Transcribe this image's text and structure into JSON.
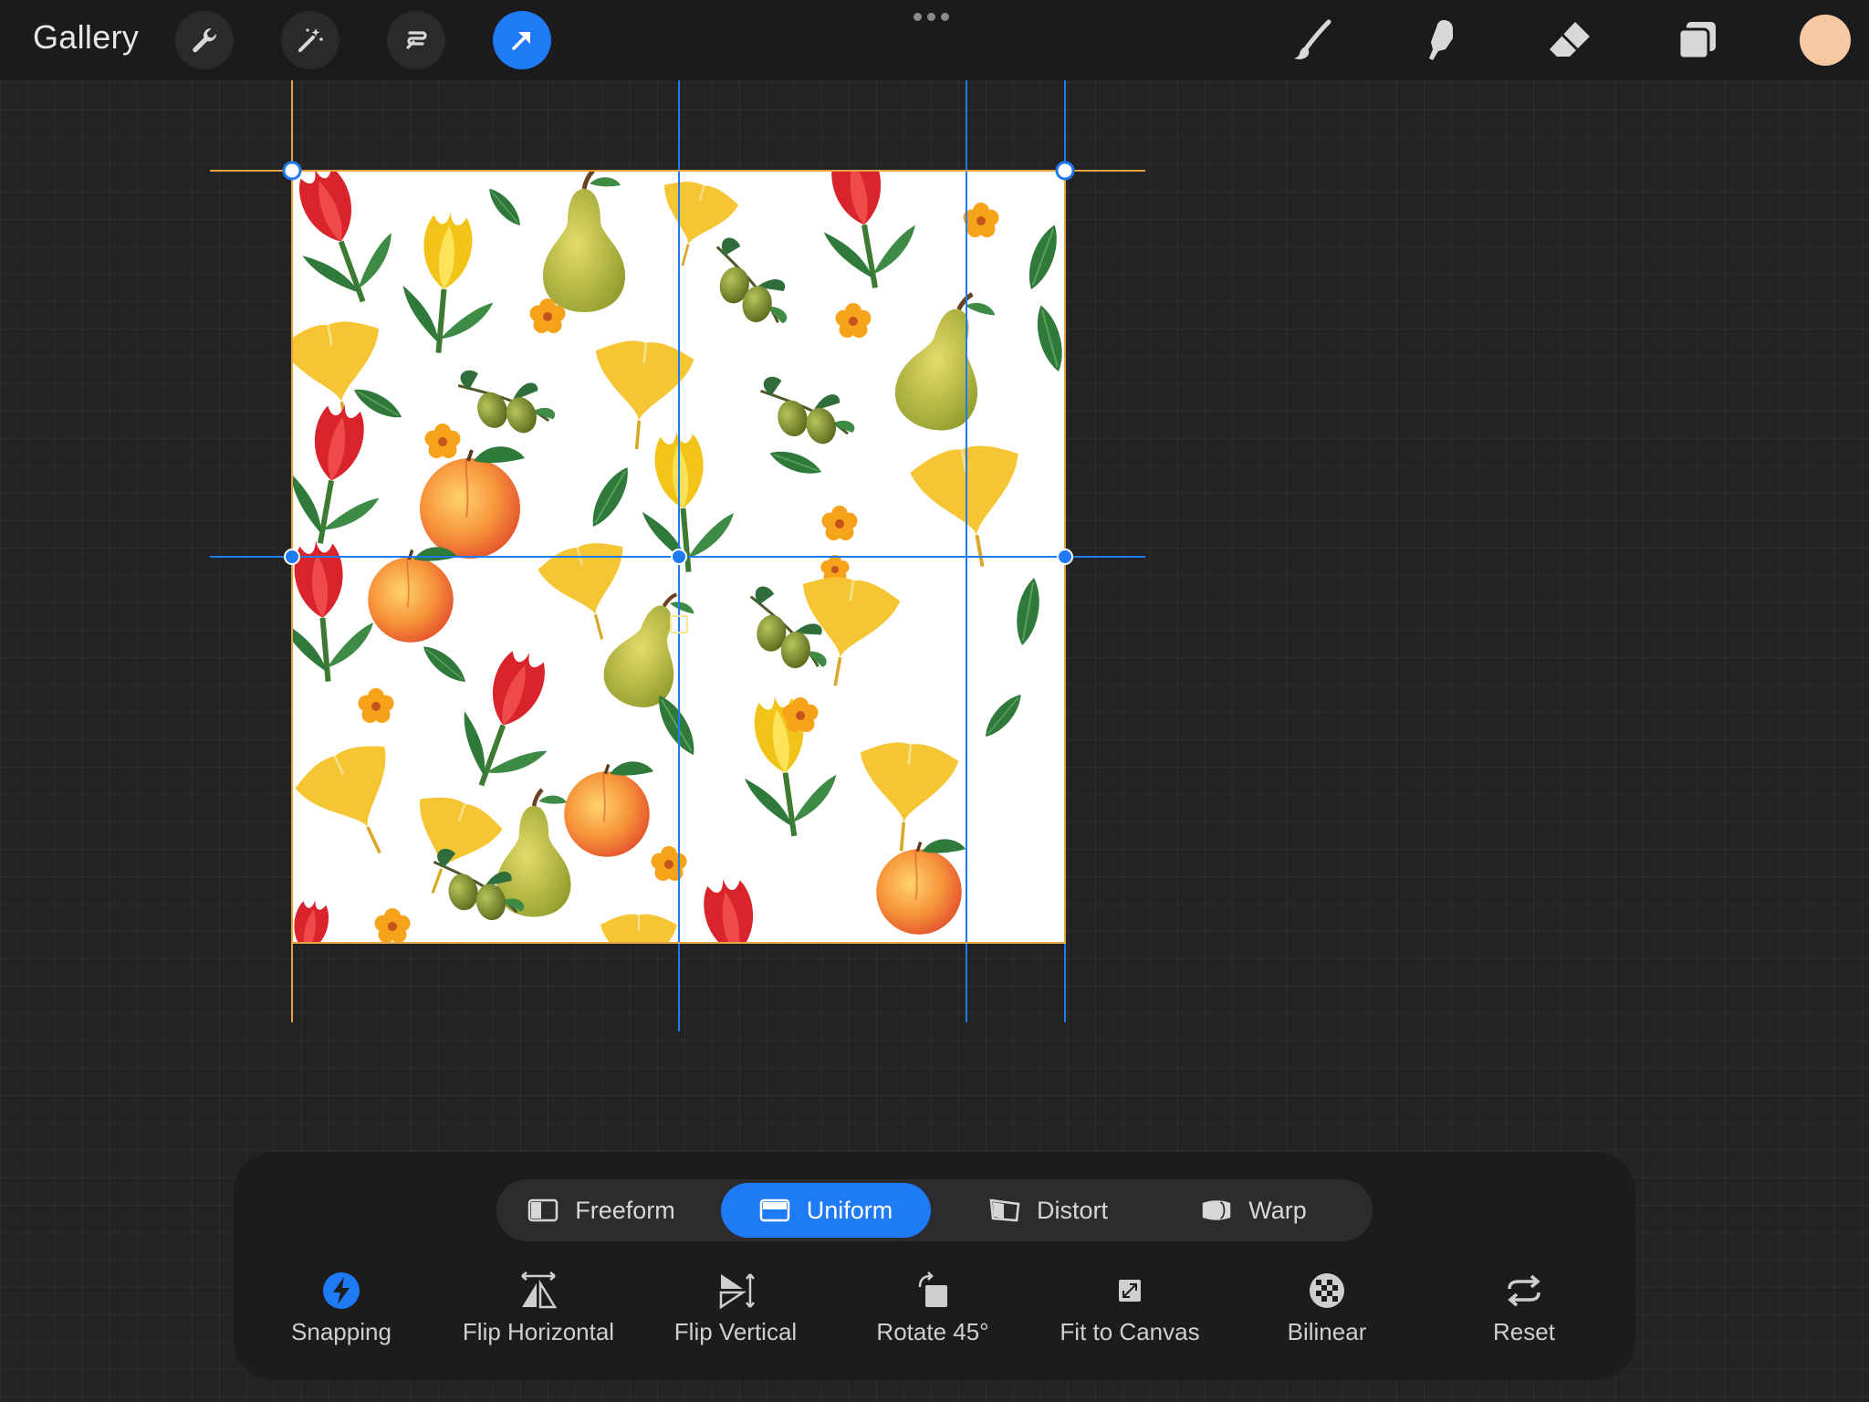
{
  "topbar": {
    "gallery_label": "Gallery",
    "left_tools": [
      {
        "name": "actions-wrench-icon",
        "active": false
      },
      {
        "name": "adjustments-magic-wand-icon",
        "active": false
      },
      {
        "name": "selection-icon",
        "active": false
      },
      {
        "name": "transform-arrow-icon",
        "active": true
      }
    ],
    "right_tools": [
      "brush-icon",
      "smudge-icon",
      "eraser-icon",
      "layers-icon"
    ],
    "current_color": "#f7c9a3",
    "accent_color": "#1f7af5"
  },
  "canvas": {
    "artwork_description_icon": "floral-fruit-pattern-image",
    "guide_color": "#1f7af5",
    "snap_guide_color": "#e6a23c"
  },
  "transform_panel": {
    "modes": [
      {
        "label": "Freeform",
        "icon": "freeform-icon",
        "active": false
      },
      {
        "label": "Uniform",
        "icon": "uniform-icon",
        "active": true
      },
      {
        "label": "Distort",
        "icon": "distort-icon",
        "active": false
      },
      {
        "label": "Warp",
        "icon": "warp-icon",
        "active": false
      }
    ],
    "actions": [
      {
        "label": "Snapping",
        "icon": "snapping-lightning-icon"
      },
      {
        "label": "Flip Horizontal",
        "icon": "flip-horizontal-icon"
      },
      {
        "label": "Flip Vertical",
        "icon": "flip-vertical-icon"
      },
      {
        "label": "Rotate 45°",
        "icon": "rotate-icon"
      },
      {
        "label": "Fit to Canvas",
        "icon": "fit-to-canvas-icon"
      },
      {
        "label": "Bilinear",
        "icon": "bilinear-icon"
      },
      {
        "label": "Reset",
        "icon": "reset-icon"
      }
    ]
  }
}
